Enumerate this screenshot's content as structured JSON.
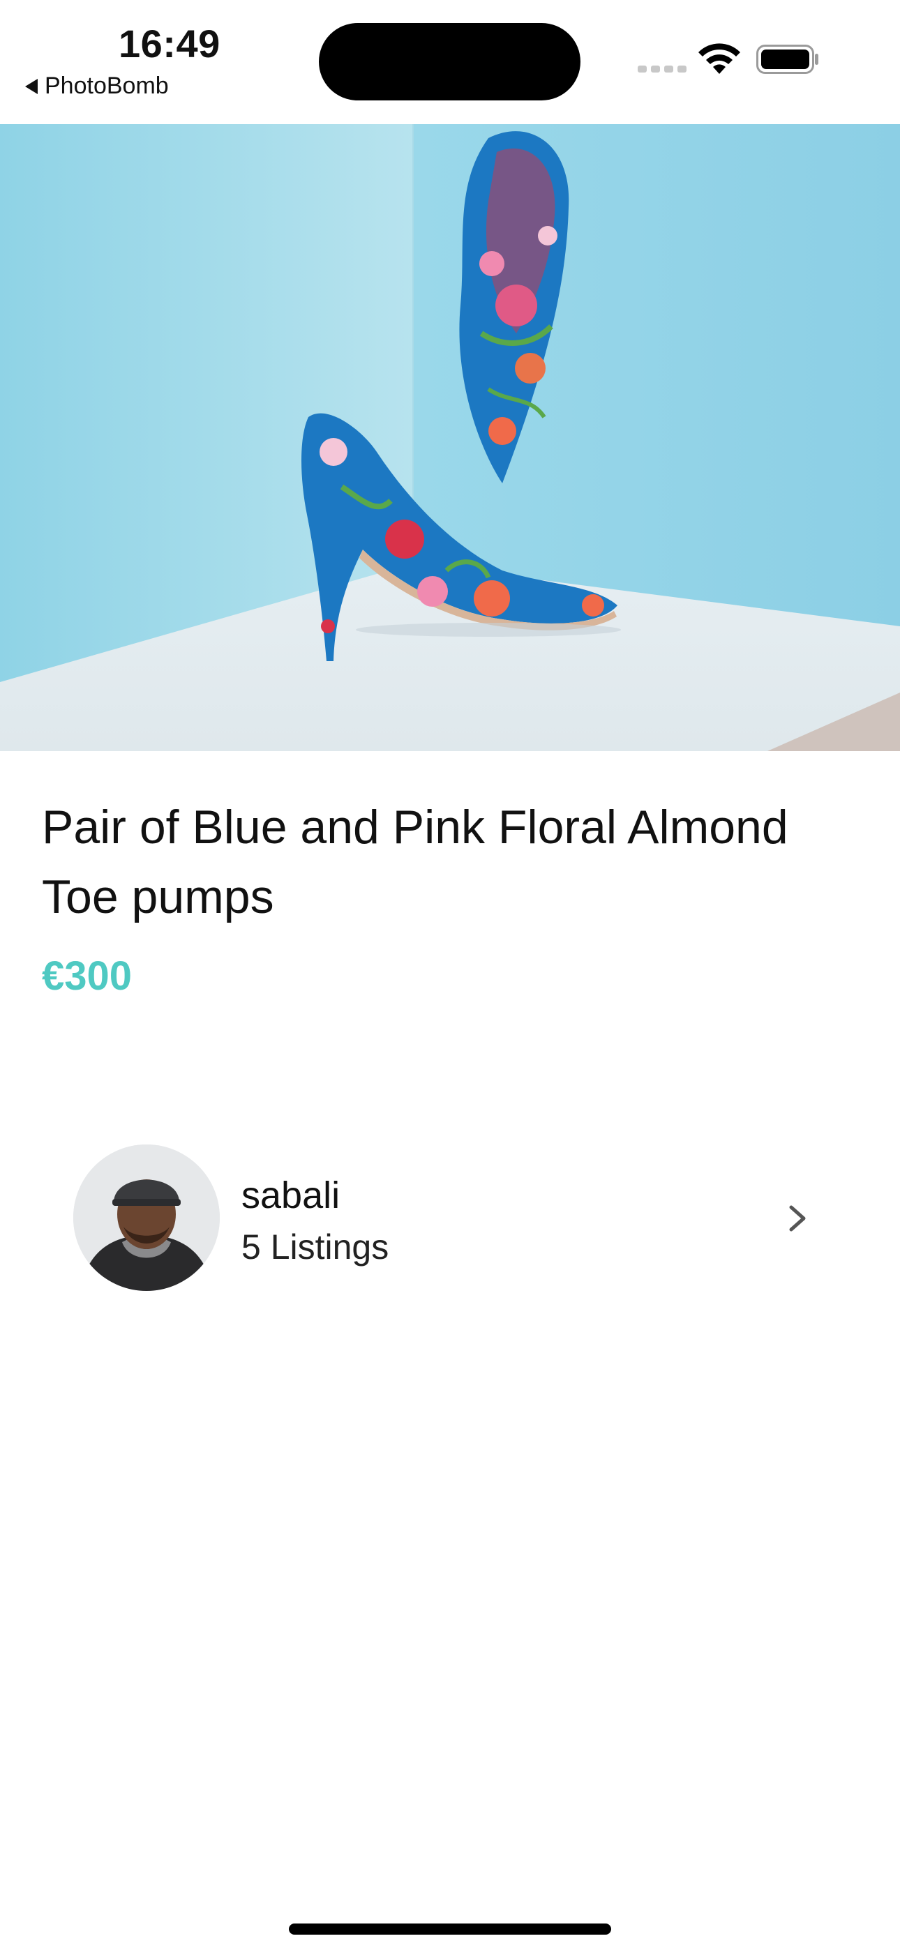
{
  "status_bar": {
    "time": "16:49",
    "back_label": "PhotoBomb"
  },
  "product": {
    "title": "Pair of Blue and Pink Floral Almond Toe pumps",
    "price": "€300",
    "image_icon": "floral-pumps-photo"
  },
  "seller": {
    "name": "sabali",
    "listings": "5 Listings"
  },
  "colors": {
    "accent": "#4fc9c2",
    "background": "#ffffff",
    "text": "#111111"
  }
}
